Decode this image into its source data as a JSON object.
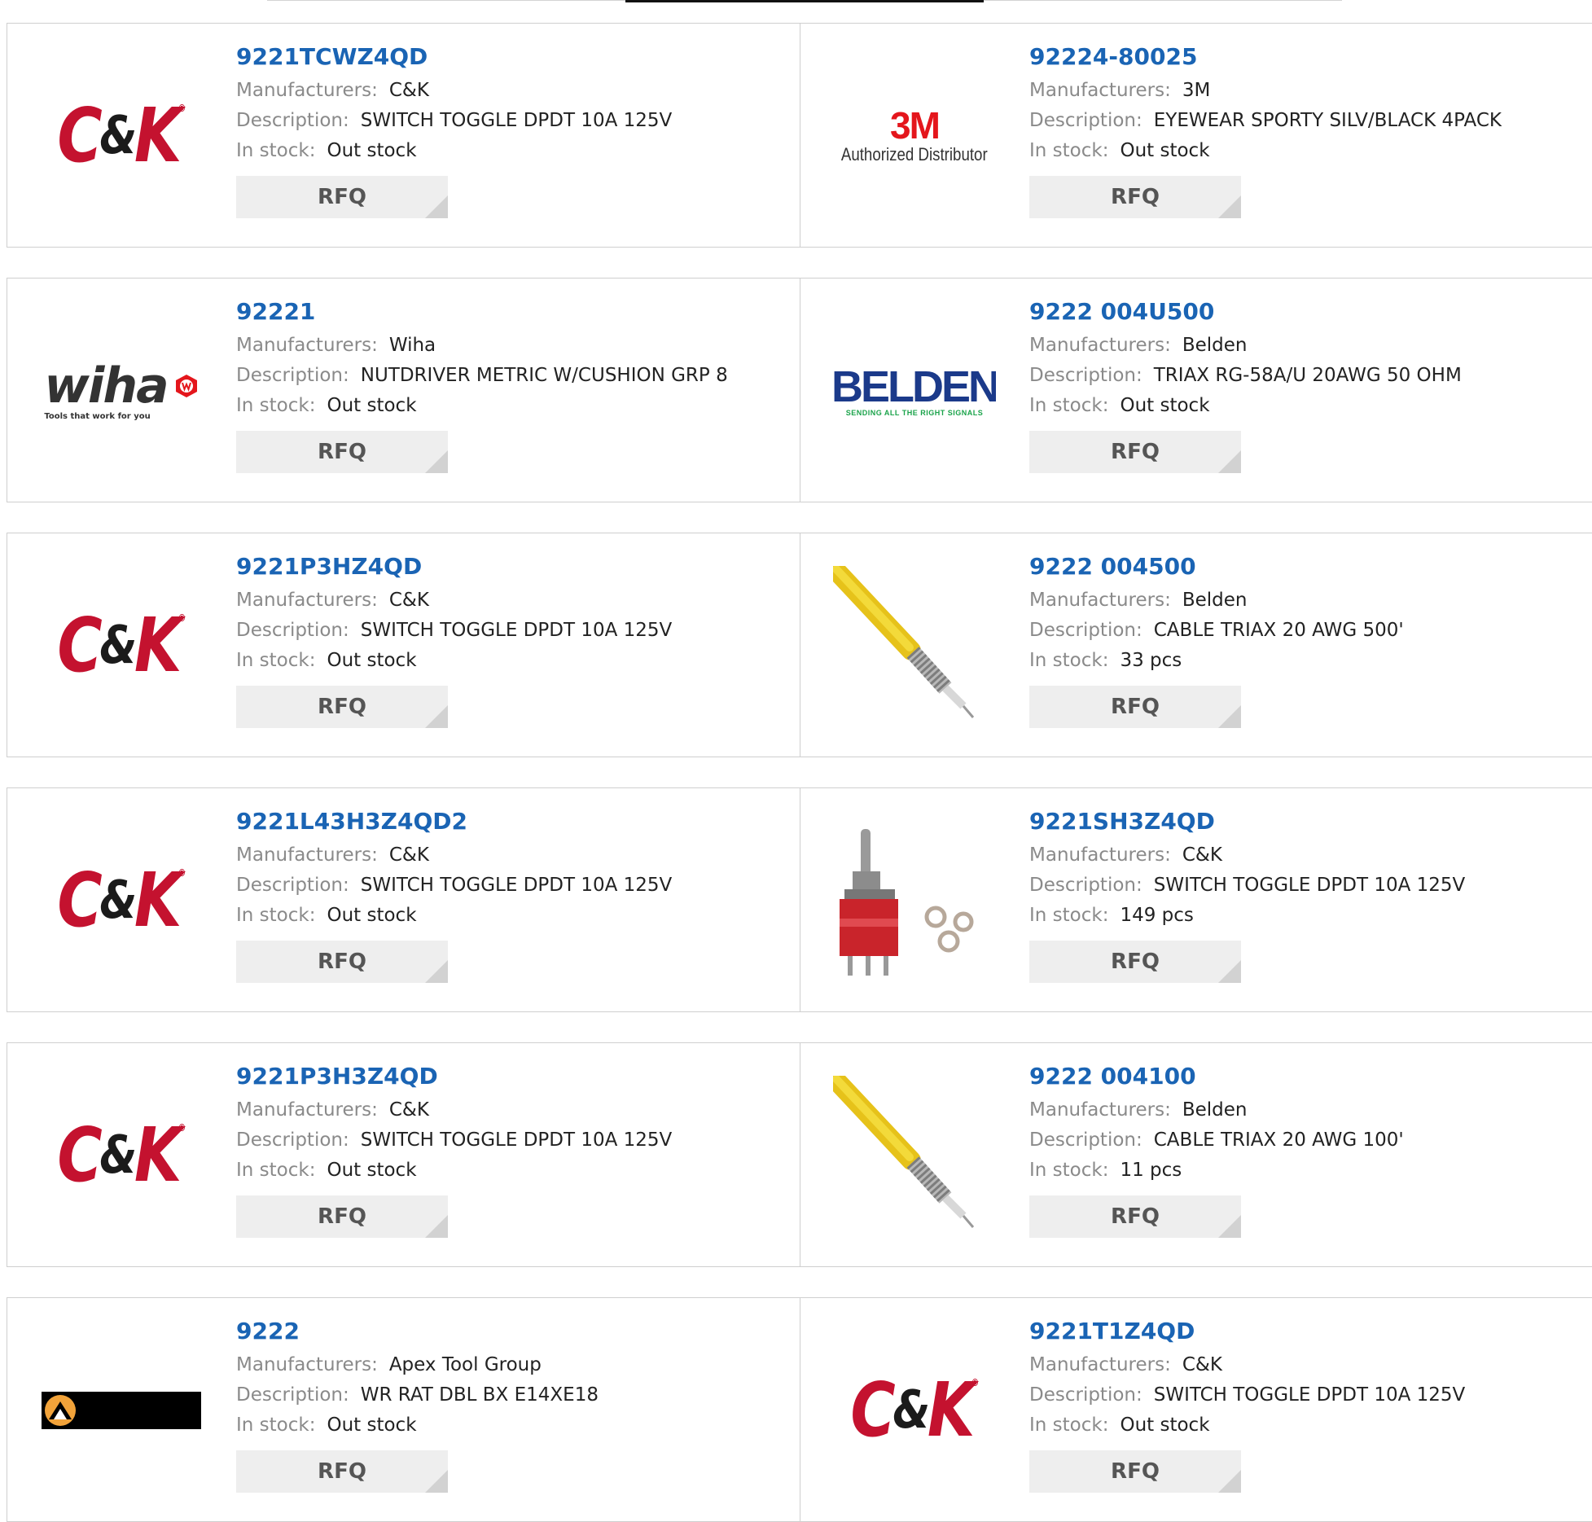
{
  "labels": {
    "manufacturers": "Manufacturers:",
    "description": "Description:",
    "in_stock": "In stock:",
    "rfq": "RFQ"
  },
  "colors": {
    "part_link": "#1a64b4",
    "ck_red": "#c4122f",
    "threem_red": "#e4161c",
    "belden_blue": "#1b3a8a",
    "belden_green": "#1aa34a",
    "cable_yellow": "#f0d21e",
    "rfq_bg": "#eeeeee"
  },
  "logo_text": {
    "threem_brand": "3M",
    "threem_sub": "Authorized Distributor",
    "wiha_brand": "wiha",
    "wiha_tag": "Tools that work for you",
    "belden_brand": "BELDEN",
    "belden_tag": "SENDING ALL THE RIGHT SIGNALS",
    "ck_c": "C",
    "ck_amp": "&",
    "ck_k": "K",
    "ck_reg": "®"
  },
  "products": [
    {
      "part": "9221TCWZ4QD",
      "manufacturer": "C&K",
      "description": "SWITCH TOGGLE DPDT 10A 125V",
      "stock": "Out stock",
      "image": "ck-logo"
    },
    {
      "part": "92224-80025",
      "manufacturer": "3M",
      "description": "EYEWEAR SPORTY SILV/BLACK 4PACK",
      "stock": "Out stock",
      "image": "3m-logo"
    },
    {
      "part": "92221",
      "manufacturer": "Wiha",
      "description": "NUTDRIVER METRIC W/CUSHION GRP 8",
      "stock": "Out stock",
      "image": "wiha-logo"
    },
    {
      "part": "9222 004U500",
      "manufacturer": "Belden",
      "description": "TRIAX RG-58A/U 20AWG 50 OHM",
      "stock": "Out stock",
      "image": "belden-logo"
    },
    {
      "part": "9221P3HZ4QD",
      "manufacturer": "C&K",
      "description": "SWITCH TOGGLE DPDT 10A 125V",
      "stock": "Out stock",
      "image": "ck-logo"
    },
    {
      "part": "9222 004500",
      "manufacturer": "Belden",
      "description": "CABLE TRIAX 20 AWG 500'",
      "stock": "33 pcs",
      "image": "yellow-cable"
    },
    {
      "part": "9221L43H3Z4QD2",
      "manufacturer": "C&K",
      "description": "SWITCH TOGGLE DPDT 10A 125V",
      "stock": "Out stock",
      "image": "ck-logo"
    },
    {
      "part": "9221SH3Z4QD",
      "manufacturer": "C&K",
      "description": "SWITCH TOGGLE DPDT 10A 125V",
      "stock": "149 pcs",
      "image": "toggle-switch"
    },
    {
      "part": "9221P3H3Z4QD",
      "manufacturer": "C&K",
      "description": "SWITCH TOGGLE DPDT 10A 125V",
      "stock": "Out stock",
      "image": "ck-logo"
    },
    {
      "part": "9222 004100",
      "manufacturer": "Belden",
      "description": "CABLE TRIAX 20 AWG 100'",
      "stock": "11 pcs",
      "image": "yellow-cable"
    },
    {
      "part": "9222",
      "manufacturer": "Apex Tool Group",
      "description": "WR RAT DBL BX E14XE18",
      "stock": "Out stock",
      "image": "apex-logo"
    },
    {
      "part": "9221T1Z4QD",
      "manufacturer": "C&K",
      "description": "SWITCH TOGGLE DPDT 10A 125V",
      "stock": "Out stock",
      "image": "ck-logo"
    }
  ]
}
